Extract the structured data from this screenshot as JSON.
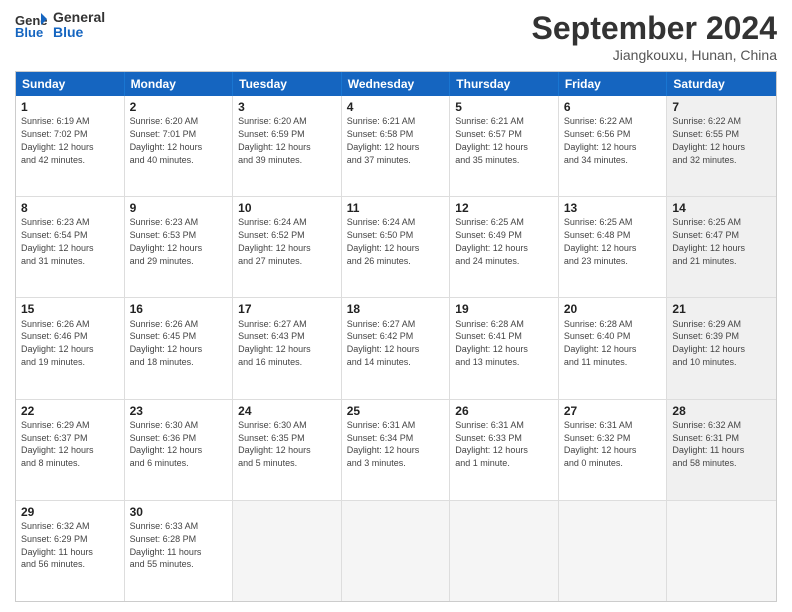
{
  "logo": {
    "line1": "General",
    "line2": "Blue"
  },
  "title": "September 2024",
  "location": "Jiangkouxu, Hunan, China",
  "days": [
    "Sunday",
    "Monday",
    "Tuesday",
    "Wednesday",
    "Thursday",
    "Friday",
    "Saturday"
  ],
  "rows": [
    [
      {
        "day": "1",
        "text": "Sunrise: 6:19 AM\nSunset: 7:02 PM\nDaylight: 12 hours\nand 42 minutes.",
        "shaded": false
      },
      {
        "day": "2",
        "text": "Sunrise: 6:20 AM\nSunset: 7:01 PM\nDaylight: 12 hours\nand 40 minutes.",
        "shaded": false
      },
      {
        "day": "3",
        "text": "Sunrise: 6:20 AM\nSunset: 6:59 PM\nDaylight: 12 hours\nand 39 minutes.",
        "shaded": false
      },
      {
        "day": "4",
        "text": "Sunrise: 6:21 AM\nSunset: 6:58 PM\nDaylight: 12 hours\nand 37 minutes.",
        "shaded": false
      },
      {
        "day": "5",
        "text": "Sunrise: 6:21 AM\nSunset: 6:57 PM\nDaylight: 12 hours\nand 35 minutes.",
        "shaded": false
      },
      {
        "day": "6",
        "text": "Sunrise: 6:22 AM\nSunset: 6:56 PM\nDaylight: 12 hours\nand 34 minutes.",
        "shaded": false
      },
      {
        "day": "7",
        "text": "Sunrise: 6:22 AM\nSunset: 6:55 PM\nDaylight: 12 hours\nand 32 minutes.",
        "shaded": true
      }
    ],
    [
      {
        "day": "8",
        "text": "Sunrise: 6:23 AM\nSunset: 6:54 PM\nDaylight: 12 hours\nand 31 minutes.",
        "shaded": false
      },
      {
        "day": "9",
        "text": "Sunrise: 6:23 AM\nSunset: 6:53 PM\nDaylight: 12 hours\nand 29 minutes.",
        "shaded": false
      },
      {
        "day": "10",
        "text": "Sunrise: 6:24 AM\nSunset: 6:52 PM\nDaylight: 12 hours\nand 27 minutes.",
        "shaded": false
      },
      {
        "day": "11",
        "text": "Sunrise: 6:24 AM\nSunset: 6:50 PM\nDaylight: 12 hours\nand 26 minutes.",
        "shaded": false
      },
      {
        "day": "12",
        "text": "Sunrise: 6:25 AM\nSunset: 6:49 PM\nDaylight: 12 hours\nand 24 minutes.",
        "shaded": false
      },
      {
        "day": "13",
        "text": "Sunrise: 6:25 AM\nSunset: 6:48 PM\nDaylight: 12 hours\nand 23 minutes.",
        "shaded": false
      },
      {
        "day": "14",
        "text": "Sunrise: 6:25 AM\nSunset: 6:47 PM\nDaylight: 12 hours\nand 21 minutes.",
        "shaded": true
      }
    ],
    [
      {
        "day": "15",
        "text": "Sunrise: 6:26 AM\nSunset: 6:46 PM\nDaylight: 12 hours\nand 19 minutes.",
        "shaded": false
      },
      {
        "day": "16",
        "text": "Sunrise: 6:26 AM\nSunset: 6:45 PM\nDaylight: 12 hours\nand 18 minutes.",
        "shaded": false
      },
      {
        "day": "17",
        "text": "Sunrise: 6:27 AM\nSunset: 6:43 PM\nDaylight: 12 hours\nand 16 minutes.",
        "shaded": false
      },
      {
        "day": "18",
        "text": "Sunrise: 6:27 AM\nSunset: 6:42 PM\nDaylight: 12 hours\nand 14 minutes.",
        "shaded": false
      },
      {
        "day": "19",
        "text": "Sunrise: 6:28 AM\nSunset: 6:41 PM\nDaylight: 12 hours\nand 13 minutes.",
        "shaded": false
      },
      {
        "day": "20",
        "text": "Sunrise: 6:28 AM\nSunset: 6:40 PM\nDaylight: 12 hours\nand 11 minutes.",
        "shaded": false
      },
      {
        "day": "21",
        "text": "Sunrise: 6:29 AM\nSunset: 6:39 PM\nDaylight: 12 hours\nand 10 minutes.",
        "shaded": true
      }
    ],
    [
      {
        "day": "22",
        "text": "Sunrise: 6:29 AM\nSunset: 6:37 PM\nDaylight: 12 hours\nand 8 minutes.",
        "shaded": false
      },
      {
        "day": "23",
        "text": "Sunrise: 6:30 AM\nSunset: 6:36 PM\nDaylight: 12 hours\nand 6 minutes.",
        "shaded": false
      },
      {
        "day": "24",
        "text": "Sunrise: 6:30 AM\nSunset: 6:35 PM\nDaylight: 12 hours\nand 5 minutes.",
        "shaded": false
      },
      {
        "day": "25",
        "text": "Sunrise: 6:31 AM\nSunset: 6:34 PM\nDaylight: 12 hours\nand 3 minutes.",
        "shaded": false
      },
      {
        "day": "26",
        "text": "Sunrise: 6:31 AM\nSunset: 6:33 PM\nDaylight: 12 hours\nand 1 minute.",
        "shaded": false
      },
      {
        "day": "27",
        "text": "Sunrise: 6:31 AM\nSunset: 6:32 PM\nDaylight: 12 hours\nand 0 minutes.",
        "shaded": false
      },
      {
        "day": "28",
        "text": "Sunrise: 6:32 AM\nSunset: 6:31 PM\nDaylight: 11 hours\nand 58 minutes.",
        "shaded": true
      }
    ],
    [
      {
        "day": "29",
        "text": "Sunrise: 6:32 AM\nSunset: 6:29 PM\nDaylight: 11 hours\nand 56 minutes.",
        "shaded": false
      },
      {
        "day": "30",
        "text": "Sunrise: 6:33 AM\nSunset: 6:28 PM\nDaylight: 11 hours\nand 55 minutes.",
        "shaded": false
      },
      {
        "day": "",
        "text": "",
        "shaded": true,
        "empty": true
      },
      {
        "day": "",
        "text": "",
        "shaded": true,
        "empty": true
      },
      {
        "day": "",
        "text": "",
        "shaded": true,
        "empty": true
      },
      {
        "day": "",
        "text": "",
        "shaded": true,
        "empty": true
      },
      {
        "day": "",
        "text": "",
        "shaded": true,
        "empty": true
      }
    ]
  ]
}
